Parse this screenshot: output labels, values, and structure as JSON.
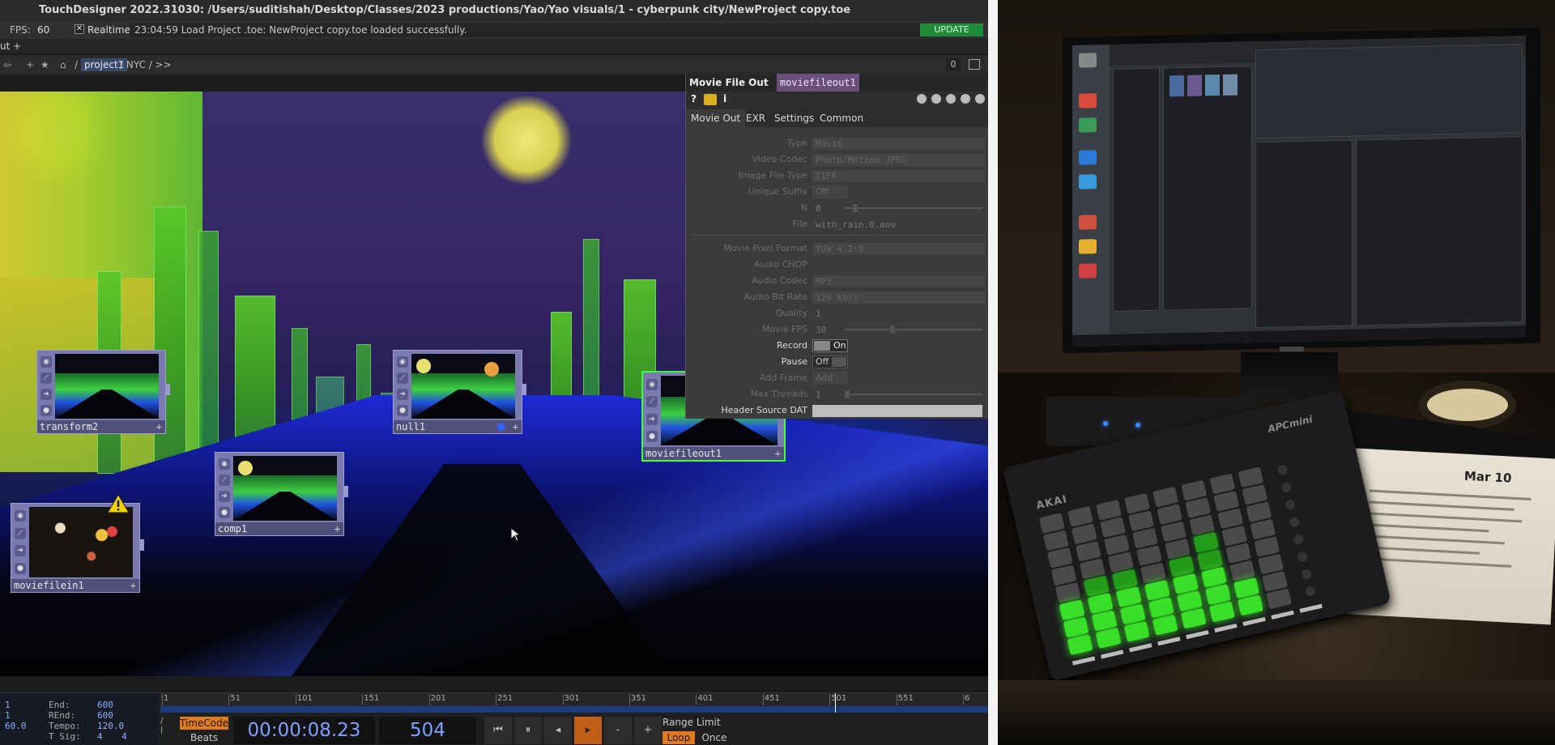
{
  "window": {
    "title": "TouchDesigner 2022.31030: /Users/suditishah/Desktop/Classes/2023 productions/Yao/Yao visuals/1 - cyberpunk city/NewProject copy.toe"
  },
  "statusbar": {
    "fps_label": "FPS:",
    "fps_value": "60",
    "realtime_check": "✕",
    "realtime_label": "Realtime",
    "message": "23:04:59 Load Project .toe: NewProject copy.toe loaded successfully.",
    "update_label": "UPDATE"
  },
  "tabrow": {
    "tab_stub": "ut",
    "add_tab": "+"
  },
  "pathbar": {
    "root_sep": "/",
    "project": "project1",
    "rest": "/  NYC  /  >>",
    "counter": "0"
  },
  "nodes": [
    {
      "name": "transform2"
    },
    {
      "name": "null1"
    },
    {
      "name": "comp1"
    },
    {
      "name": "moviefilein1"
    },
    {
      "name": "moviefileout1"
    }
  ],
  "param_panel": {
    "op_type": "Movie File Out",
    "op_name": "moviefileout1",
    "tools": {
      "help": "?",
      "info": "i"
    },
    "tabs": [
      "Movie Out",
      "EXR",
      "Settings",
      "Common"
    ],
    "params": {
      "type": {
        "label": "Type",
        "value": "Movie"
      },
      "video_codec": {
        "label": "Video Codec",
        "value": "Photo/Motion JPEG"
      },
      "image_file_type": {
        "label": "Image File Type",
        "value": "TIFF"
      },
      "unique_suffix": {
        "label": "Unique Suffix",
        "value": "Off"
      },
      "n": {
        "label": "N",
        "value": "0"
      },
      "file": {
        "label": "File",
        "value": "with_rain.0.mov"
      },
      "movie_pixel_format": {
        "label": "Movie Pixel Format",
        "value": "YUV 4:2:0"
      },
      "audio_chop": {
        "label": "Audio CHOP",
        "value": ""
      },
      "audio_codec": {
        "label": "Audio Codec",
        "value": "MP3"
      },
      "audio_bit_rate": {
        "label": "Audio Bit Rate",
        "value": "128 kb/s"
      },
      "quality": {
        "label": "Quality",
        "value": "1"
      },
      "movie_fps": {
        "label": "Movie FPS",
        "value": "30"
      },
      "record": {
        "label": "Record",
        "value": "On"
      },
      "pause": {
        "label": "Pause",
        "value": "Off"
      },
      "add_frame": {
        "label": "Add Frame",
        "value": "Add"
      },
      "max_threads": {
        "label": "Max Threads",
        "value": "1"
      },
      "header_source_dat": {
        "label": "Header Source DAT",
        "value": ""
      }
    }
  },
  "timeline": {
    "info": {
      "start": "1",
      "end_label": "End:",
      "end": "600",
      "rstart": "1",
      "rend_label": "REnd:",
      "rend": "600",
      "fps": "60.0",
      "tempo_label": "Tempo:",
      "tempo": "120.0",
      "tsig_label": "T Sig:",
      "tsig_num": "4",
      "tsig_den": "4"
    },
    "ruler_ticks": [
      "1",
      "51",
      "101",
      "151",
      "201",
      "251",
      "301",
      "351",
      "401",
      "451",
      "501",
      "551",
      "6"
    ],
    "current_frame": 504,
    "total_frames": 600,
    "timecode_label": "TimeCode",
    "beats_label": "Beats",
    "timecode": "00:00:08.23",
    "frame": "504",
    "buttons": {
      "rewind": "⏮",
      "pause": "⏸",
      "step_back": "◂",
      "play": "▸",
      "minus": "-",
      "plus": "+"
    },
    "range_limit_label": "Range Limit",
    "loop_label": "Loop",
    "once_label": "Once"
  },
  "photo": {
    "apc_brand": "AKAI",
    "apc_model": "APCmini",
    "paper_title": "Mar 10"
  },
  "colors": {
    "accent_orange": "#e07a20",
    "update_green": "#1f8c3a",
    "node_purple": "#7a7ab0",
    "pad_green": "#38e028"
  }
}
